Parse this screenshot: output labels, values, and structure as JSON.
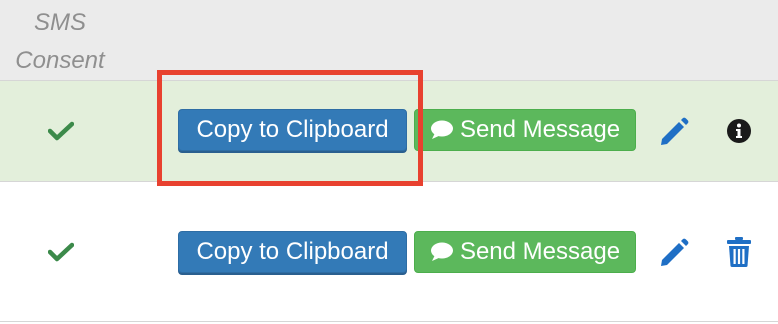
{
  "header": {
    "sms_consent": "SMS Consent"
  },
  "rows": [
    {
      "sms_consent_icon": "check-icon",
      "copy_label": "Copy to Clipboard",
      "send_label": "Send Message",
      "send_icon": "chat-bubble-icon",
      "actions": [
        "edit-icon",
        "info-icon"
      ]
    },
    {
      "sms_consent_icon": "check-icon",
      "copy_label": "Copy to Clipboard",
      "send_label": "Send Message",
      "send_icon": "chat-bubble-icon",
      "actions": [
        "edit-icon",
        "trash-icon"
      ]
    }
  ],
  "colors": {
    "primary": "#337ab7",
    "success": "#5cb85c",
    "check": "#3c8a4a",
    "highlight_row": "#e3efdb",
    "annotation": "#e8412f"
  }
}
